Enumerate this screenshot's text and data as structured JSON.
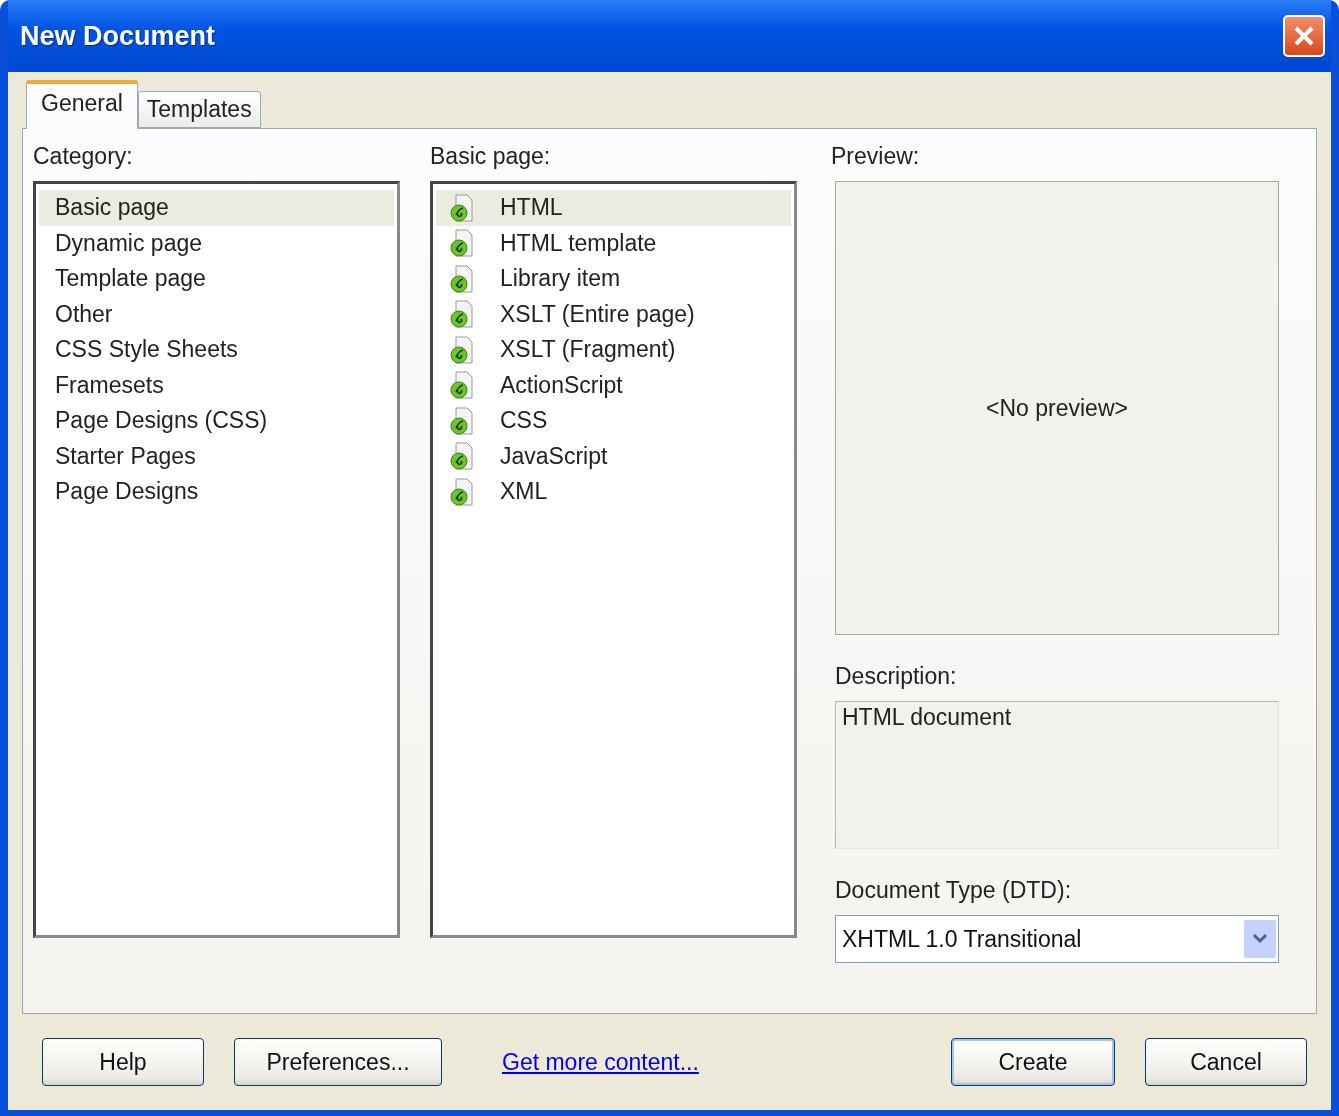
{
  "window": {
    "title": "New Document"
  },
  "tabs": [
    {
      "label": "General",
      "selected": true
    },
    {
      "label": "Templates",
      "selected": false
    }
  ],
  "category": {
    "label": "Category:",
    "items": [
      {
        "label": "Basic page",
        "selected": true
      },
      {
        "label": "Dynamic page",
        "selected": false
      },
      {
        "label": "Template page",
        "selected": false
      },
      {
        "label": "Other",
        "selected": false
      },
      {
        "label": "CSS Style Sheets",
        "selected": false
      },
      {
        "label": "Framesets",
        "selected": false
      },
      {
        "label": "Page Designs (CSS)",
        "selected": false
      },
      {
        "label": "Starter Pages",
        "selected": false
      },
      {
        "label": "Page Designs",
        "selected": false
      }
    ]
  },
  "types": {
    "label": "Basic page:",
    "items": [
      {
        "label": "HTML",
        "selected": true
      },
      {
        "label": "HTML template",
        "selected": false
      },
      {
        "label": "Library item",
        "selected": false
      },
      {
        "label": "XSLT (Entire page)",
        "selected": false
      },
      {
        "label": "XSLT (Fragment)",
        "selected": false
      },
      {
        "label": "ActionScript",
        "selected": false
      },
      {
        "label": "CSS",
        "selected": false
      },
      {
        "label": "JavaScript",
        "selected": false
      },
      {
        "label": "XML",
        "selected": false
      }
    ]
  },
  "preview": {
    "label": "Preview:",
    "text": "<No preview>"
  },
  "description": {
    "label": "Description:",
    "text": "HTML document"
  },
  "doctype": {
    "label": "Document Type (DTD):",
    "value": "XHTML 1.0 Transitional"
  },
  "buttons_left": [
    "Help",
    "Preferences..."
  ],
  "link": "Get more content...",
  "buttons_right": [
    {
      "label": "Create",
      "default": true
    },
    {
      "label": "Cancel",
      "default": false
    }
  ]
}
